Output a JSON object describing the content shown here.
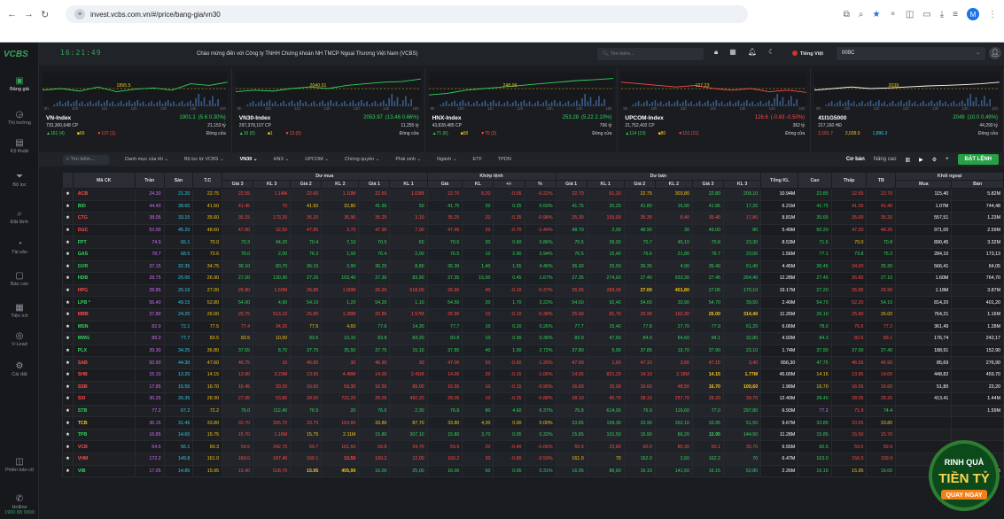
{
  "browser": {
    "url": "invest.vcbs.com.vn/#/price/bang-gia/vn30",
    "profile": "M"
  },
  "header": {
    "logo": "VCBS",
    "clock": "16:21:49",
    "marquee": "Chào mừng đến với Công ty TNHH Chứng khoán NH TMCP Ngoại Thương Việt Nam (VCBS)",
    "search_placeholder": "Tìm kiếm...",
    "language": "Tiếng Việt",
    "account": "009C"
  },
  "sidebar": {
    "items": [
      {
        "label": "Bảng giá",
        "icon": "price-board-icon"
      },
      {
        "label": "Thị trường",
        "icon": "market-icon"
      },
      {
        "label": "Kỹ thuật",
        "icon": "technical-icon"
      },
      {
        "label": "Bộ lọc",
        "icon": "filter-icon"
      },
      {
        "label": "Đặt lệnh",
        "icon": "order-icon"
      },
      {
        "label": "Tài sản",
        "icon": "asset-icon"
      },
      {
        "label": "Báo cáo",
        "icon": "report-icon"
      },
      {
        "label": "Tiện ích",
        "icon": "utility-icon"
      },
      {
        "label": "V-Lead",
        "icon": "vlead-icon"
      },
      {
        "label": "Cài đặt",
        "icon": "settings-icon"
      },
      {
        "label": "Phiên bản cũ",
        "icon": "old-version-icon"
      },
      {
        "label": "Hotline",
        "icon": "hotline-icon"
      }
    ],
    "hotline": "1900 88 9999"
  },
  "indexes": [
    {
      "name": "VN-Index",
      "value": "1901.1",
      "change": "(5.6 0.30%)",
      "dir": "up",
      "volume": "733,300,648 CP",
      "amount": "21,153 tỷ",
      "up": "▲161 (4)",
      "ref": "■69",
      "down": "▼137 (1)",
      "status": "Đóng cửa",
      "ref_label": "1895.5",
      "axis": [
        "9h",
        "10h",
        "11h",
        "12h",
        "13h",
        "14h",
        "15h"
      ]
    },
    {
      "name": "VN30-Index",
      "value": "2053.97",
      "change": "(13.46 0.66%)",
      "dir": "up",
      "volume": "297,378,107 CP",
      "amount": "11,255 tỷ",
      "up": "▲16 (0)",
      "ref": "■1",
      "down": "▼13 (0)",
      "status": "Đóng cửa",
      "ref_label": "2040.51",
      "axis": [
        "9h",
        "10h",
        "11h",
        "12h",
        "13h",
        "14h",
        "15h"
      ]
    },
    {
      "name": "HNX-Index",
      "value": "253.28",
      "change": "(5.22 2.10%)",
      "dir": "up",
      "volume": "43,828,485 CP",
      "amount": "796 tỷ",
      "up": "▲71 (6)",
      "ref": "■58",
      "down": "▼75 (2)",
      "status": "Đóng cửa",
      "ref_label": "248.06",
      "axis": [
        "9h",
        "10h",
        "11h",
        "12h",
        "13h",
        "14h",
        "15h"
      ]
    },
    {
      "name": "UPCOM-Index",
      "value": "126.6",
      "change": "(-0.63 -0.50%)",
      "dir": "dn",
      "volume": "21,752,402 CP",
      "amount": "362 tỷ",
      "up": "▲114 (13)",
      "ref": "■80",
      "down": "▼101 (11)",
      "status": "Đóng cửa",
      "ref_label": "127.23",
      "axis": [
        "9h",
        "10h",
        "11h",
        "12h",
        "13h",
        "14h",
        "15h"
      ]
    },
    {
      "name": "41I1G5000",
      "value": "2049",
      "change": "(10.0 0.49%)",
      "dir": "up",
      "volume": "217,160 HĐ",
      "amount": "44,290 tỷ",
      "up": "2,181.7",
      "ref": "2,039.0",
      "down": "1,896.3",
      "status": "Đóng cửa",
      "ref_label": "2039",
      "axis": [
        "9h",
        "10h",
        "11h",
        "12h",
        "13h",
        "14h",
        "15h"
      ]
    }
  ],
  "filters": {
    "search": "Tìm kiếm...",
    "tabs": [
      "Danh mục của tôi ⌄",
      "Bộ lọc từ VCBS ⌄",
      "VN30 ⌄",
      "HNX ⌄",
      "UPCOM ⌄",
      "Chứng quyền ⌄",
      "Phái sinh ⌄",
      "Ngành ⌄",
      "ETF",
      "TPDN"
    ],
    "active": 2,
    "mode_basic": "Cơ bản",
    "mode_adv": "Nâng cao",
    "order_btn": "ĐẶT LỆNH"
  },
  "table": {
    "group_headers": {
      "buy": "Dư mua",
      "match": "Khớp lệnh",
      "sell": "Dư bán",
      "foreign": "Khối ngoại"
    },
    "columns": [
      "Mã CK",
      "Trần",
      "Sàn",
      "T.C",
      "Giá 3",
      "KL 3",
      "Giá 2",
      "KL 2",
      "Giá 1",
      "KL 1",
      "Giá",
      "KL",
      "+/-",
      "%",
      "Giá 1",
      "KL 1",
      "Giá 2",
      "KL 2",
      "Giá 3",
      "KL 3",
      "Tổng KL",
      "Cao",
      "Thấp",
      "TB",
      "Mua",
      "Bán"
    ],
    "rows": [
      [
        "ACB",
        "24.30",
        "21.20",
        "22.75",
        "22.55",
        "1.14M",
        "22.60",
        "1.10M",
        "22.65",
        "1.03M",
        "22.70",
        "8,20",
        "-0.05",
        "-0.22%",
        "22.70",
        "61,20",
        "22.75",
        "303,80",
        "22.80",
        "209,10",
        "10.94M",
        "22.85",
        "22.65",
        "22.70",
        "115,40",
        "5.82M"
      ],
      [
        "BID",
        "44.40",
        "38.60",
        "41.50",
        "41.45",
        "70",
        "41.50",
        "32,80",
        "41.60",
        "50",
        "41.75",
        "20",
        "0.25",
        "0.60%",
        "41.75",
        "20,20",
        "41.80",
        "16,90",
        "41.85",
        "17,20",
        "6.21M",
        "41.75",
        "41.05",
        "41.40",
        "1.07M",
        "744,48"
      ],
      [
        "CTG",
        "38.05",
        "33.15",
        "35.60",
        "35.15",
        "173,20",
        "35.20",
        "36,90",
        "35.25",
        "3,10",
        "35.25",
        "20",
        "-0.35",
        "-0.98%",
        "35.30",
        "159,00",
        "35.35",
        "8,40",
        "35.40",
        "17,80",
        "8.81M",
        "35.65",
        "35.00",
        "35.20",
        "557,51",
        "1.23M"
      ],
      [
        "DGC",
        "52.00",
        "45.20",
        "48.60",
        "47.80",
        "32,50",
        "47.85",
        "2,70",
        "47.90",
        "7,00",
        "47.90",
        "20",
        "-0.70",
        "-1.44%",
        "48.70",
        "2,00",
        "48.90",
        "30",
        "49.00",
        "80",
        "5.49M",
        "50.20",
        "47.20",
        "48.20",
        "971,00",
        "2.59M"
      ],
      [
        "FPT",
        "74.9",
        "65.1",
        "70.0",
        "70.3",
        "94,20",
        "70.4",
        "7,10",
        "70.5",
        "60",
        "70.6",
        "30",
        "0.60",
        "0.86%",
        "70.6",
        "39,00",
        "70.7",
        "45,10",
        "70.8",
        "23,30",
        "8.53M",
        "71.5",
        "70.0",
        "70.8",
        "890,45",
        "3.32M"
      ],
      [
        "GAS",
        "78.7",
        "68.5",
        "73.6",
        "76.0",
        "2,00",
        "76.3",
        "1,00",
        "76.4",
        "2,00",
        "76.5",
        "10",
        "2.90",
        "3.94%",
        "76.5",
        "15,40",
        "76.6",
        "21,80",
        "76.7",
        "23,00",
        "1.56M",
        "77.1",
        "73.8",
        "75.2",
        "284,10",
        "173,13"
      ],
      [
        "GVR",
        "37.15",
        "32.35",
        "34.75",
        "36.10",
        "80,70",
        "36.15",
        "2,90",
        "36.25",
        "8,80",
        "36.30",
        "1,40",
        "1.55",
        "4.46%",
        "36.30",
        "25,50",
        "36.35",
        "4,90",
        "36.40",
        "61,40",
        "4.45M",
        "36.45",
        "34.20",
        "35.30",
        "566,41",
        "64,05"
      ],
      [
        "HDB",
        "28.75",
        "25.05",
        "26.90",
        "27.20",
        "130,30",
        "27.25",
        "103,40",
        "27.30",
        "83,90",
        "27.35",
        "15,00",
        "0.45",
        "1.67%",
        "27.35",
        "274,60",
        "27.40",
        "933,30",
        "27.45",
        "264,40",
        "12.28M",
        "27.45",
        "26.80",
        "27.10",
        "1.60M",
        "764,70"
      ],
      [
        "HPG",
        "28.85",
        "25.15",
        "27.00",
        "26.80",
        "1.69M",
        "26.85",
        "1.60M",
        "26.90",
        "618,00",
        "26.90",
        "40",
        "-0.10",
        "-0.37%",
        "26.95",
        "289,00",
        "27.00",
        "401,80",
        "27.05",
        "170,10",
        "19.17M",
        "27.20",
        "26.85",
        "26.90",
        "1.18M",
        "3.87M"
      ],
      [
        "LPB *",
        "56.40",
        "49.15",
        "52.80",
        "54.00",
        "4,90",
        "54.10",
        "1,20",
        "54.20",
        "1,10",
        "54.50",
        "20",
        "1.70",
        "3.22%",
        "54.50",
        "92,40",
        "54.60",
        "33,90",
        "54.70",
        "39,50",
        "2.49M",
        "54.70",
        "52.20",
        "54.10",
        "814,20",
        "401,20"
      ],
      [
        "MBB",
        "27.80",
        "24.20",
        "26.00",
        "25.75",
        "513,10",
        "25.80",
        "1.28M",
        "25.85",
        "1.57M",
        "25.90",
        "10",
        "-0.10",
        "-0.38%",
        "25.90",
        "81,70",
        "25.95",
        "192,30",
        "26.00",
        "314,40",
        "11.26M",
        "26.10",
        "25.90",
        "26.00",
        "764,21",
        "1.16M"
      ],
      [
        "MSN",
        "82.9",
        "72.1",
        "77.5",
        "77.4",
        "34,20",
        "77.5",
        "4,60",
        "77.6",
        "14,30",
        "77.7",
        "10",
        "0.20",
        "0.26%",
        "77.7",
        "15,40",
        "77.8",
        "27,70",
        "77.9",
        "61,20",
        "6.06M",
        "78.0",
        "76.6",
        "77.2",
        "361,49",
        "1.28M"
      ],
      [
        "MWG",
        "89.3",
        "77.7",
        "83.5",
        "83.5",
        "10,50",
        "83.6",
        "10,10",
        "83.8",
        "84,20",
        "83.8",
        "10",
        "0.30",
        "0.36%",
        "83.9",
        "47,50",
        "84.0",
        "64,60",
        "84.1",
        "32,80",
        "4.93M",
        "84.3",
        "82.6",
        "83.1",
        "176,74",
        "242,17"
      ],
      [
        "PLX",
        "39.30",
        "34.25",
        "36.80",
        "37.65",
        "8,70",
        "37.70",
        "35,50",
        "37.75",
        "15,10",
        "37.80",
        "40",
        "1.00",
        "2.72%",
        "37.80",
        "5,90",
        "37.85",
        "19,70",
        "37.90",
        "23,10",
        "1.74M",
        "37.90",
        "37.00",
        "37.40",
        "188,91",
        "152,90"
      ],
      [
        "SAB",
        "50.90",
        "44.30",
        "47.60",
        "46.75",
        "10",
        "46.85",
        "30",
        "46.90",
        "30",
        "47.00",
        "50",
        "-0.60",
        "-1.26%",
        "47.00",
        "1,60",
        "47.10",
        "3,60",
        "47.15",
        "3,40",
        "656,30",
        "47.75",
        "46.55",
        "46.90",
        "85,69",
        "276,90"
      ],
      [
        "SHB",
        "15.10",
        "13.20",
        "14.15",
        "13.90",
        "3.23M",
        "13.95",
        "4.48M",
        "14.00",
        "2.41M",
        "14.00",
        "20",
        "-0.15",
        "-1.06%",
        "14.05",
        "821,20",
        "14.10",
        "2.18M",
        "14.15",
        "1.77M",
        "45.00M",
        "14.15",
        "13.95",
        "14.00",
        "448,82",
        "459,70"
      ],
      [
        "SSB",
        "17.85",
        "15.55",
        "16.70",
        "16.45",
        "20,20",
        "16.50",
        "59,30",
        "16.55",
        "89,00",
        "16.55",
        "10",
        "-0.15",
        "-0.90%",
        "16.60",
        "15,00",
        "16.65",
        "48,50",
        "16.70",
        "100,60",
        "1.96M",
        "16.70",
        "16.55",
        "16.60",
        "51,80",
        "23,20"
      ],
      [
        "SSI",
        "30.25",
        "26.35",
        "28.30",
        "27.95",
        "53,80",
        "28.00",
        "722,20",
        "28.05",
        "492,20",
        "28.05",
        "10",
        "-0.25",
        "-0.88%",
        "28.10",
        "40,70",
        "28.15",
        "257,70",
        "28.20",
        "39,70",
        "12.40M",
        "28.40",
        "28.05",
        "28.20",
        "413,41",
        "1.44M"
      ],
      [
        "STB",
        "77.2",
        "67.2",
        "72.2",
        "76.0",
        "112,40",
        "76.5",
        "20",
        "76.6",
        "2,30",
        "76.8",
        "80",
        "4.60",
        "6.37%",
        "76.8",
        "614,90",
        "76.9",
        "116,60",
        "77.0",
        "297,80",
        "6.93M",
        "77.2",
        "71.9",
        "74.4",
        "",
        "1.59M"
      ],
      [
        "TCB",
        "36.15",
        "31.45",
        "33.80",
        "33.70",
        "355,70",
        "33.75",
        "163,80",
        "33.80",
        "87,70",
        "33.80",
        "4,30",
        "0.00",
        "0.00%",
        "33.85",
        "199,30",
        "33.90",
        "262,10",
        "33.95",
        "51,50",
        "9.67M",
        "33.85",
        "33.65",
        "33.80",
        "",
        ""
      ],
      [
        "TPB",
        "16.85",
        "14.65",
        "15.75",
        "15.70",
        "1.16M",
        "15.75",
        "2.11M",
        "15.80",
        "307,10",
        "15.80",
        "3,70",
        "0.05",
        "0.32%",
        "15.85",
        "101,50",
        "15.90",
        "86,20",
        "15.95",
        "144,50",
        "11.28M",
        "15.85",
        "15.50",
        "15.70",
        "",
        ""
      ],
      [
        "VCB",
        "64.5",
        "56.1",
        "60.3",
        "59.6",
        "342,70",
        "59.7",
        "161,50",
        "59.8",
        "34,70",
        "59.9",
        "20",
        "-0.40",
        "-0.66%",
        "59.9",
        "23,80",
        "60.0",
        "80,30",
        "60.1",
        "30,70",
        "6.55M",
        "60.5",
        "59.5",
        "59.9",
        "",
        ""
      ],
      [
        "VHM",
        "172.2",
        "149.8",
        "161.0",
        "160.0",
        "187,40",
        "160.1",
        "10,50",
        "160.2",
        "12,00",
        "160.2",
        "30",
        "-0.80",
        "-0.50%",
        "161.0",
        "70",
        "162.0",
        "2,60",
        "162.2",
        "70",
        "6.47M",
        "163.0",
        "156.0",
        "159.9",
        "",
        ""
      ],
      [
        "VIB",
        "17.05",
        "14.85",
        "15.95",
        "15.90",
        "528,70",
        "15.95",
        "405,90",
        "16.00",
        "25,00",
        "16.00",
        "50",
        "0.05",
        "0.31%",
        "16.05",
        "88,60",
        "16.10",
        "141,50",
        "16.15",
        "52,80",
        "2.26M",
        "16.10",
        "15.95",
        "16.00",
        "",
        "3,05"
      ]
    ]
  },
  "banner": {
    "line1": "RINH QUÀ",
    "line2": "TIỀN TỶ",
    "line3": "QUAY NGAY"
  },
  "colors": {
    "up": "#32d35d",
    "down": "#ff4a4a",
    "ref": "#f5c518",
    "ceil": "#d36bff",
    "floor": "#38c9e6",
    "brand": "#3aa35a"
  }
}
